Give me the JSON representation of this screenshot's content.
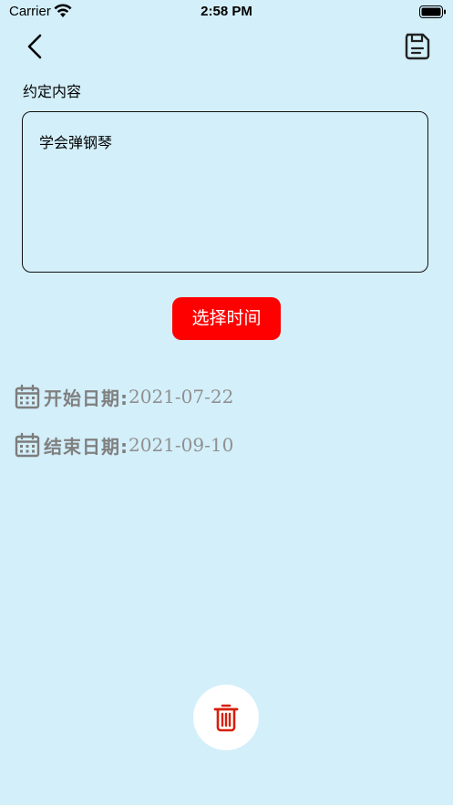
{
  "status_bar": {
    "carrier": "Carrier",
    "time": "2:58 PM"
  },
  "header": {
    "back_icon": "chevron-left-icon",
    "save_icon": "save-floppy-icon"
  },
  "form": {
    "content_label": "约定内容",
    "content_value": "学会弹钢琴",
    "select_time_button": "选择时间"
  },
  "dates": {
    "start_label": "开始日期:",
    "start_value": "2021-07-22",
    "end_label": "结束日期:",
    "end_value": "2021-09-10",
    "icon": "calendar-icon"
  },
  "footer": {
    "delete_icon": "trash-icon"
  },
  "colors": {
    "background": "#d3effa",
    "accent_red": "#ff0000",
    "trash_red": "#d81e06",
    "date_gray": "#808080"
  }
}
